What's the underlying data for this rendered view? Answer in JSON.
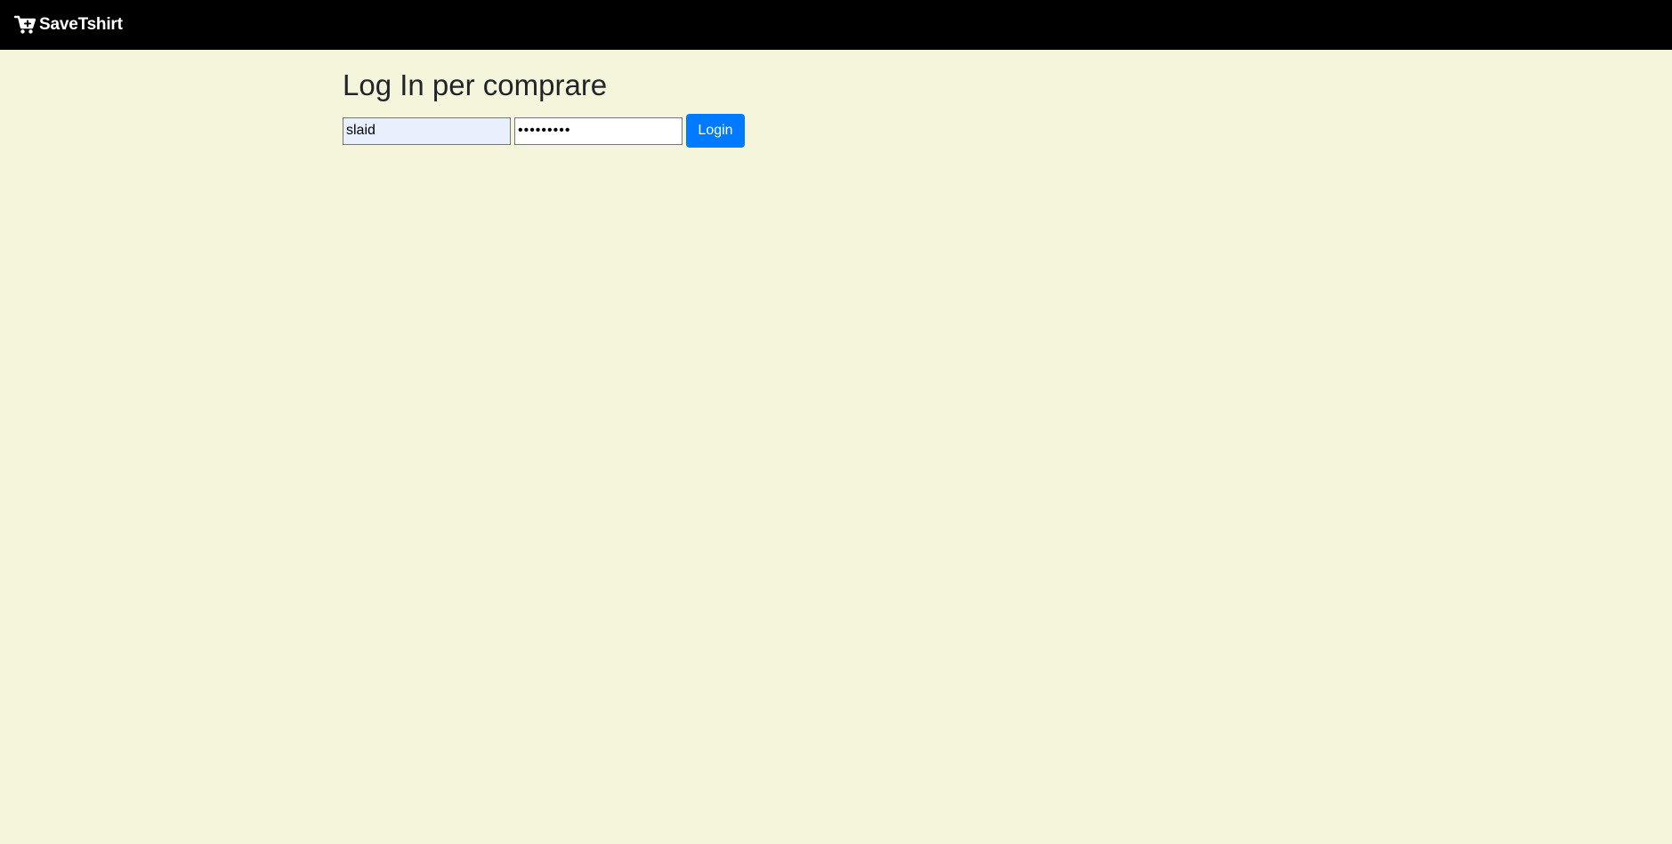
{
  "navbar": {
    "brand_name": "SaveTshirt",
    "brand_icon": "cart-plus-icon"
  },
  "main": {
    "title": "Log In per comprare"
  },
  "login_form": {
    "username_value": "slaid",
    "password_value": "123456789",
    "submit_label": "Login"
  },
  "colors": {
    "navbar_bg": "#000000",
    "page_bg": "#f5f5dc",
    "primary_button": "#007bff",
    "autofill_bg": "#e8f0fe"
  }
}
